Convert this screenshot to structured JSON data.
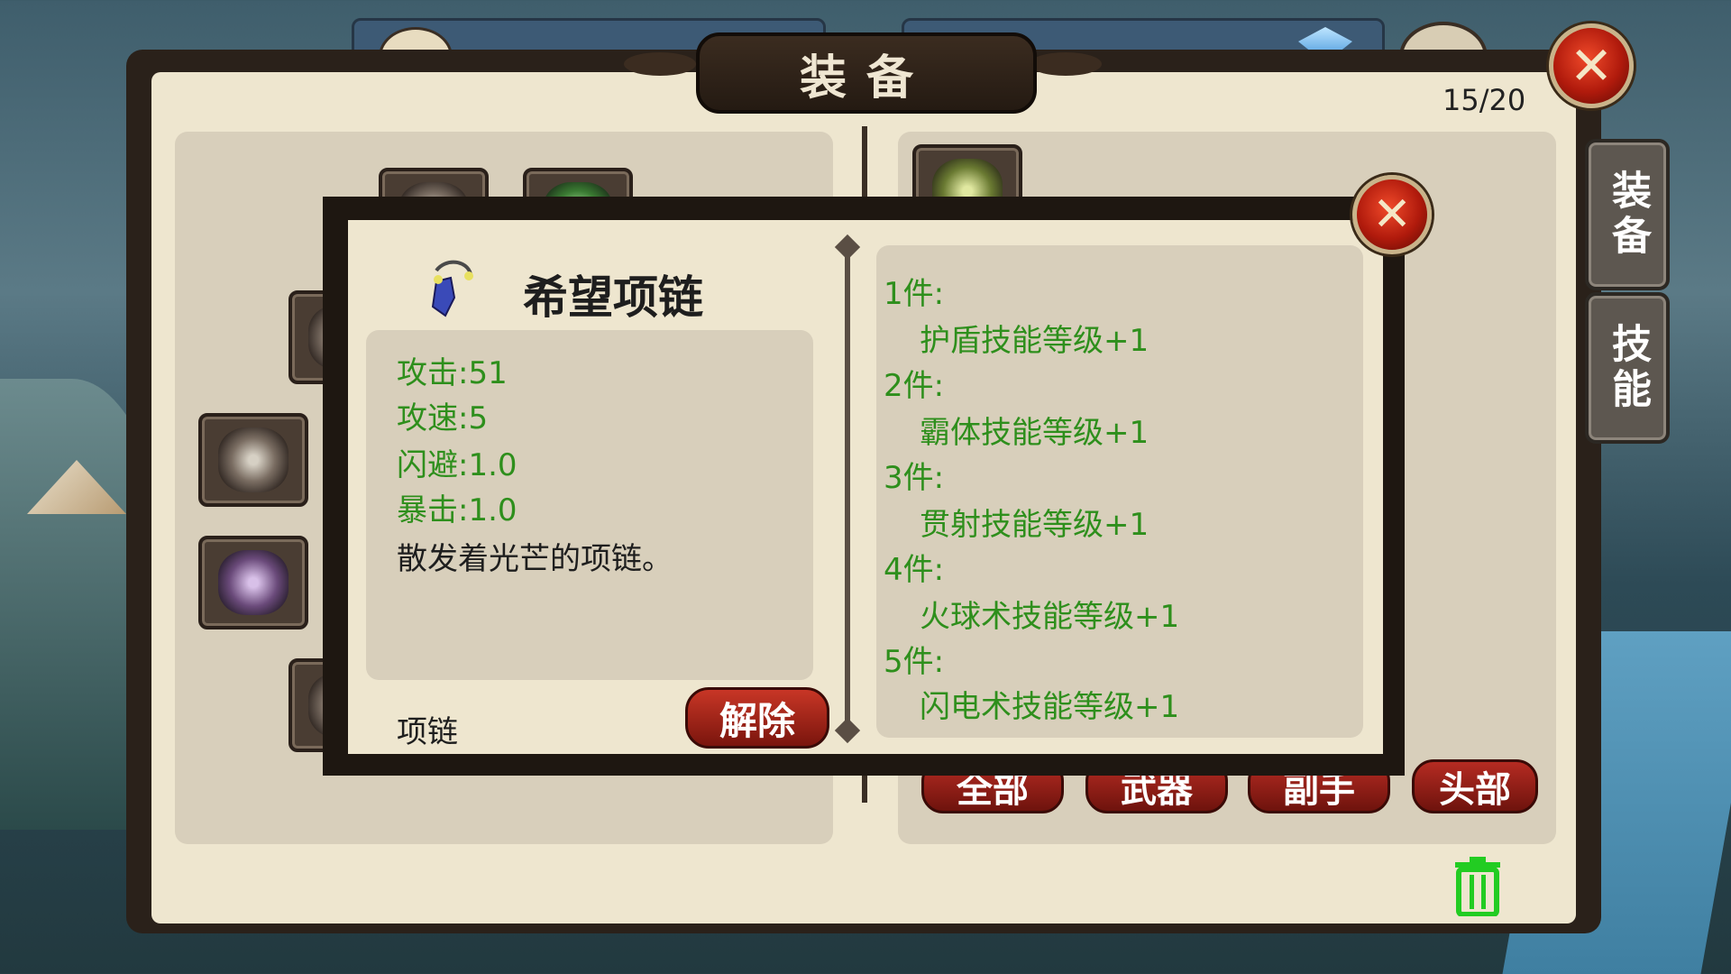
{
  "window": {
    "title": "装备",
    "counter": "15/20"
  },
  "side_tabs": {
    "equipment": "装备",
    "skills": "技能"
  },
  "filters": {
    "all": "全部",
    "weapon": "武器",
    "offhand": "副手",
    "head": "头部"
  },
  "popup": {
    "item_name": "希望项链",
    "stats": [
      "攻击:51",
      "攻速:5",
      "闪避:1.0",
      "暴击:1.0"
    ],
    "description": "散发着光芒的项链。",
    "item_type": "项链",
    "unequip_label": "解除",
    "set_bonuses": [
      {
        "pieces": "1件:",
        "bonus": "护盾技能等级+1"
      },
      {
        "pieces": "2件:",
        "bonus": "霸体技能等级+1"
      },
      {
        "pieces": "3件:",
        "bonus": "贯射技能等级+1"
      },
      {
        "pieces": "4件:",
        "bonus": "火球术技能等级+1"
      },
      {
        "pieces": "5件:",
        "bonus": "闪电术技能等级+1"
      }
    ]
  },
  "icons": {
    "close": "close-icon",
    "trash": "trash-icon",
    "necklace": "necklace-icon"
  },
  "colors": {
    "stat_green": "#2e8f1c",
    "button_red": "#b52b22",
    "panel_cream": "#eee6cf",
    "frame_dark": "#2a211a"
  }
}
